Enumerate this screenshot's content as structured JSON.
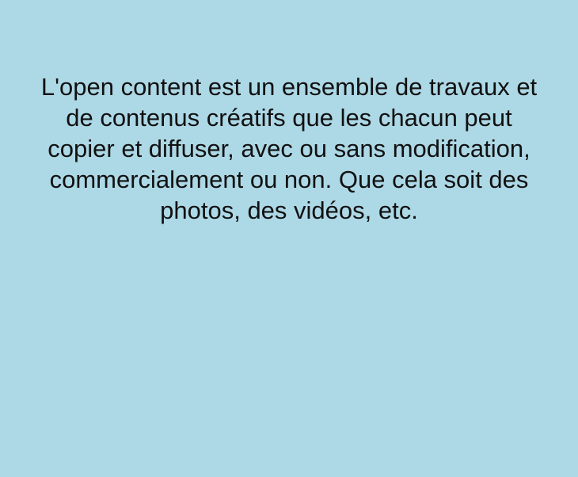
{
  "slide": {
    "background_color": "#add8e6",
    "text_color": "#111111",
    "body_text": "L'open content est un ensemble de travaux et de contenus créatifs que les chacun peut copier et diffuser, avec ou sans modification, commercialement ou non. Que cela soit des photos, des vidéos, etc."
  }
}
